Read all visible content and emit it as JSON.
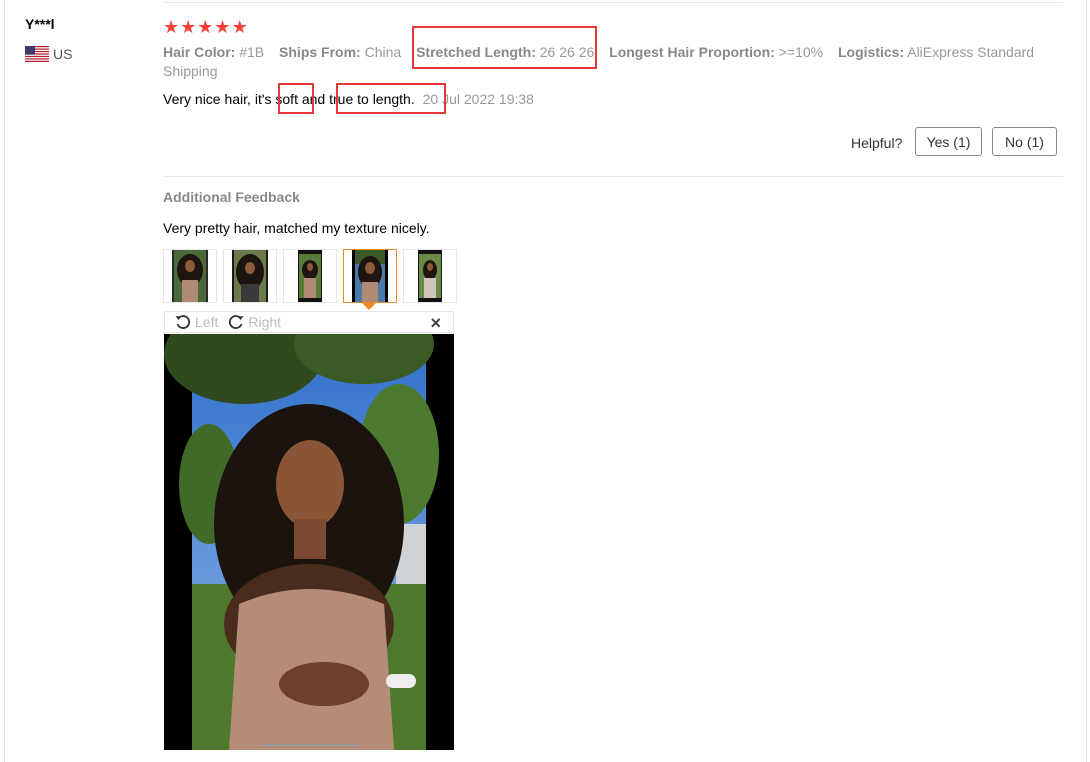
{
  "review": {
    "user": "Y***l",
    "country": "US",
    "rating": 5,
    "attributes": [
      {
        "key": "Hair Color:",
        "value": "#1B"
      },
      {
        "key": "Ships From:",
        "value": "China"
      },
      {
        "key": "Stretched Length:",
        "value": "26 26 26"
      },
      {
        "key": "Longest Hair Proportion:",
        "value": ">=10%"
      },
      {
        "key": "Logistics:",
        "value": "AliExpress Standard Shipping"
      }
    ],
    "text_parts": [
      "Very nice hair, it's ",
      "soft",
      " and ",
      "true to length."
    ],
    "date": "20 Jul 2022 19:38"
  },
  "helpful": {
    "label": "Helpful?",
    "yes": "Yes (1)",
    "no": "No (1)"
  },
  "additional": {
    "title": "Additional Feedback",
    "text": "Very pretty hair, matched my texture nicely.",
    "thumb_count": 5,
    "active_thumb": 4
  },
  "viewer": {
    "left_label": "Left",
    "right_label": "Right",
    "close_icon": "close-icon"
  },
  "colors": {
    "star": "#f44336",
    "highlight": "#e53935",
    "active_thumb": "#e88a2b"
  }
}
